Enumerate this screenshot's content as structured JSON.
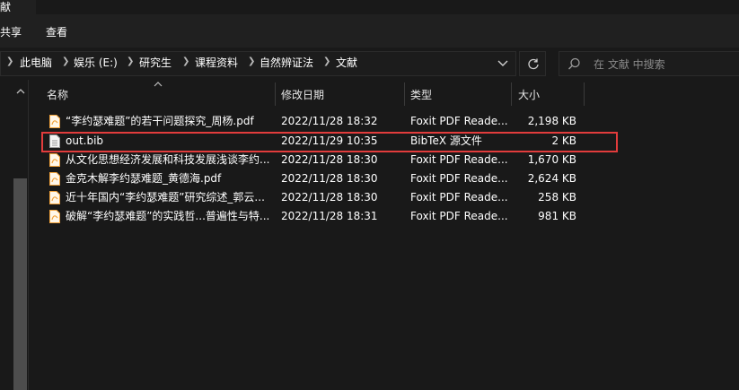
{
  "window": {
    "title_fragment": "献"
  },
  "ribbon": {
    "tabs": [
      "共享",
      "查看"
    ]
  },
  "address": {
    "breadcrumbs": [
      "此电脑",
      "娱乐 (E:)",
      "研究生",
      "课程资料",
      "自然辨证法",
      "文献"
    ]
  },
  "search": {
    "placeholder": "在 文献 中搜索"
  },
  "columns": {
    "name": "名称",
    "modified": "修改日期",
    "type": "类型",
    "size": "大小"
  },
  "files": [
    {
      "icon": "pdf-file-icon",
      "name": "“李约瑟难题”的若干问题探究_周杨.pdf",
      "modified": "2022/11/28 18:32",
      "type": "Foxit PDF Reade...",
      "size": "2,198 KB"
    },
    {
      "icon": "text-file-icon",
      "name": "out.bib",
      "modified": "2022/11/29 10:35",
      "type": "BibTeX 源文件",
      "size": "2 KB"
    },
    {
      "icon": "pdf-file-icon",
      "name": "从文化思想经济发展和科技发展浅谈李约...",
      "modified": "2022/11/28 18:30",
      "type": "Foxit PDF Reade...",
      "size": "1,670 KB"
    },
    {
      "icon": "pdf-file-icon",
      "name": "金克木解李约瑟难题_黄德海.pdf",
      "modified": "2022/11/28 18:30",
      "type": "Foxit PDF Reade...",
      "size": "2,624 KB"
    },
    {
      "icon": "pdf-file-icon",
      "name": "近十年国内“李约瑟难题”研究综述_郭云...",
      "modified": "2022/11/28 18:30",
      "type": "Foxit PDF Reade...",
      "size": "258 KB"
    },
    {
      "icon": "pdf-file-icon",
      "name": "破解“李约瑟难题”的实践哲...普遍性与特...",
      "modified": "2022/11/28 18:31",
      "type": "Foxit PDF Reade...",
      "size": "981 KB"
    }
  ],
  "colors": {
    "background": "#191919",
    "highlight_border": "#e23c3c",
    "pdf_icon": "#f2a23a"
  }
}
